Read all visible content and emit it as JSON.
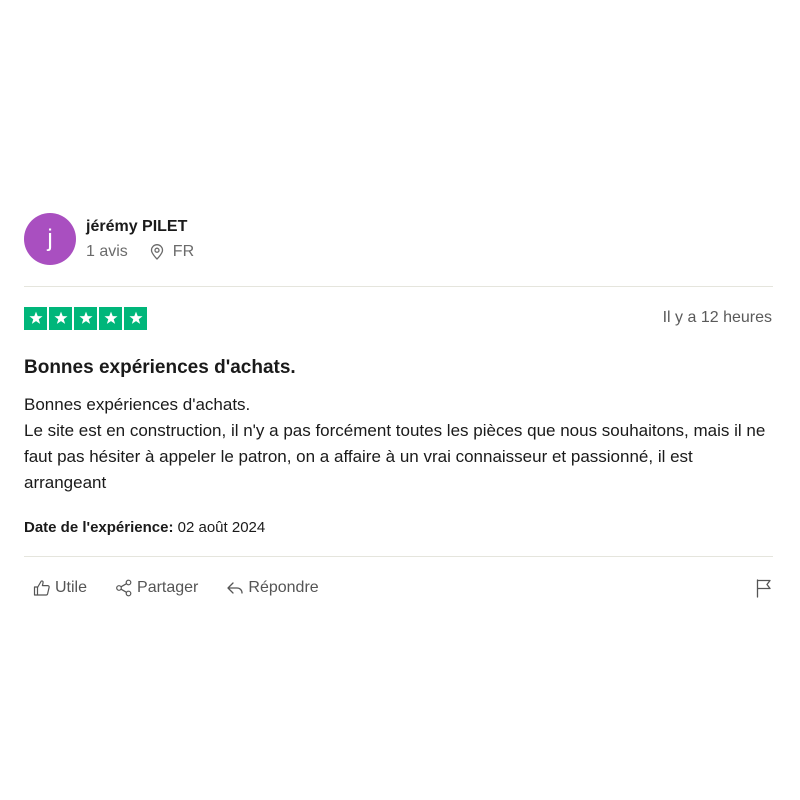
{
  "reviewer": {
    "initial": "j",
    "name": "jérémy PILET",
    "reviews_count": "1 avis",
    "country": "FR",
    "avatar_color": "#a94fc0"
  },
  "review": {
    "rating": 5,
    "rating_max": 5,
    "star_color": "#00b67a",
    "posted": "Il y a 12 heures",
    "title": "Bonnes expériences d'achats.",
    "body": [
      "Bonnes expériences d'achats.",
      "Le site est en construction, il n'y a pas forcément toutes les pièces que nous souhaitons, mais il ne faut pas hésiter à appeler le patron, on a affaire à un vrai connaisseur et passionné, il est arrangeant"
    ],
    "experience_label": "Date de l'expérience:",
    "experience_date": "02 août 2024"
  },
  "actions": {
    "useful": "Utile",
    "share": "Partager",
    "reply": "Répondre",
    "icons": [
      "thumbs-up-icon",
      "share-icon",
      "reply-icon",
      "flag-icon"
    ]
  }
}
